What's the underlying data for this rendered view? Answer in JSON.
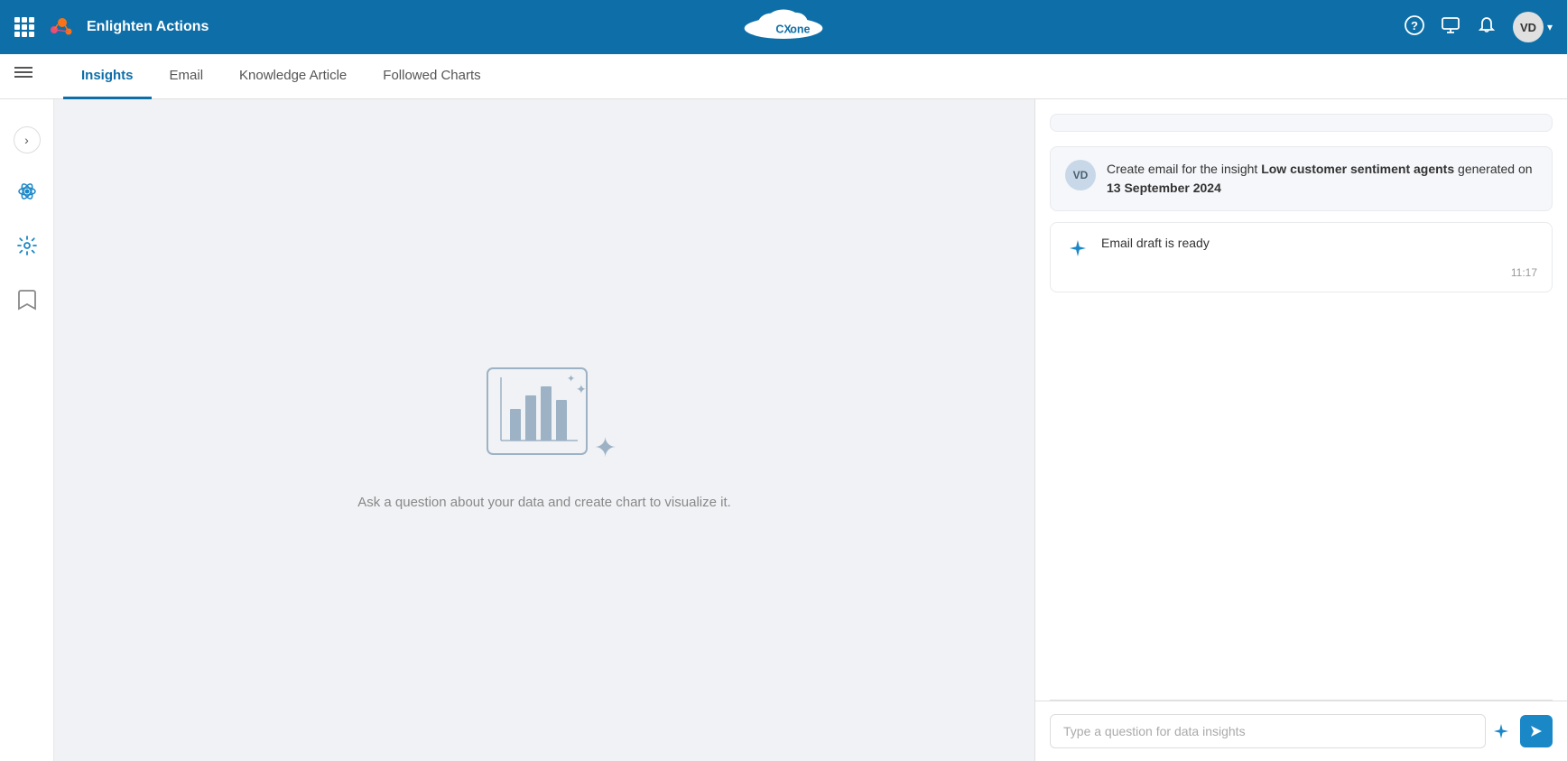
{
  "navbar": {
    "brand_name": "Enlighten Actions",
    "logo_text": "CXone",
    "user_initials": "VD"
  },
  "tabs": {
    "items": [
      {
        "label": "Insights",
        "active": true
      },
      {
        "label": "Email",
        "active": false
      },
      {
        "label": "Knowledge Article",
        "active": false
      },
      {
        "label": "Followed Charts",
        "active": false
      }
    ]
  },
  "empty_state": {
    "text": "Ask a question about your data and create chart to visualize it."
  },
  "chat": {
    "messages": [
      {
        "type": "user",
        "avatar": "VD",
        "text_prefix": "Create email for the insight ",
        "text_bold": "Low customer sentiment agents",
        "text_suffix": " generated on ",
        "text_bold2": "13 September 2024"
      },
      {
        "type": "ai",
        "text": "Email draft is ready",
        "time": "11:17"
      }
    ],
    "input_placeholder": "Type a question for data insights"
  },
  "icons": {
    "grid": "⊞",
    "help": "?",
    "monitor": "🖥",
    "bell": "🔔",
    "chevron": "▾",
    "hamburger": "☰",
    "collapse_arrow": "›",
    "bookmark": "🔖",
    "send_arrow": "➤",
    "ai_diamond": "✦"
  }
}
